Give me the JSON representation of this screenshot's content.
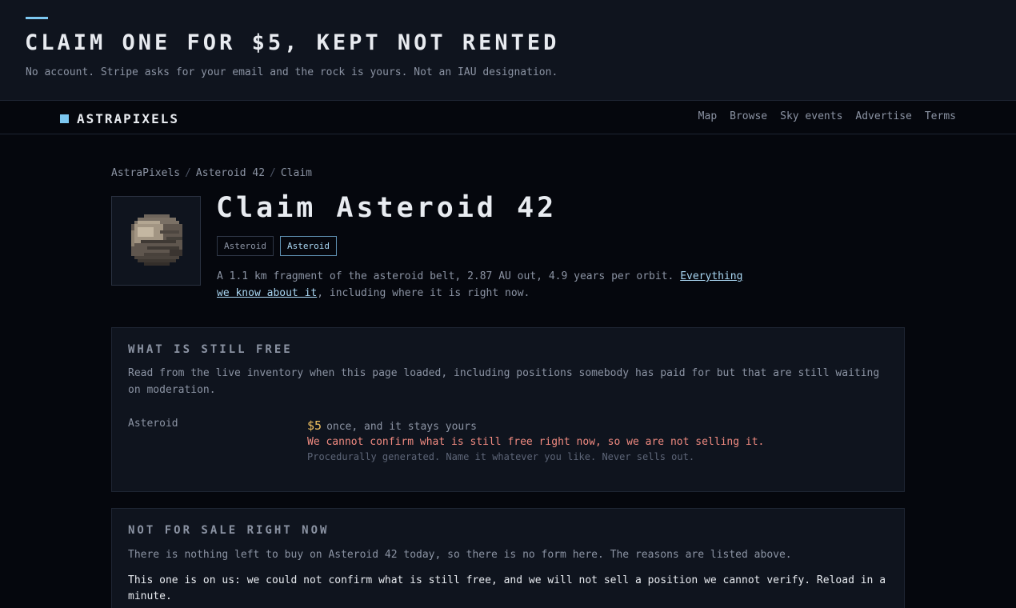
{
  "banner": {
    "title": "CLAIM ONE FOR $5, KEPT NOT RENTED",
    "subtitle": "No account. Stripe asks for your email and the rock is yours. Not an IAU designation."
  },
  "nav": {
    "logo": "ASTRAPIXELS",
    "links": [
      "Map",
      "Browse",
      "Sky events",
      "Advertise",
      "Terms"
    ]
  },
  "breadcrumb": [
    "AstraPixels",
    "Asteroid 42",
    "Claim"
  ],
  "page": {
    "title": "Claim Asteroid 42",
    "tags": [
      "Asteroid",
      "Asteroid"
    ],
    "description_prefix": "A 1.1 km fragment of the asteroid belt, 2.87 AU out, 4.9 years per orbit. ",
    "description_link": "Everything we know about it",
    "description_suffix": ", including where it is right now."
  },
  "free_panel": {
    "heading": "WHAT IS STILL FREE",
    "text": "Read from the live inventory when this page loaded, including positions somebody has paid for but that are still waiting on moderation.",
    "item_label": "Asteroid",
    "price": "$5",
    "price_suffix": "once, and it stays yours",
    "warning": "We cannot confirm what is still free right now, so we are not selling it.",
    "fine_print": "Procedurally generated. Name it whatever you like. Never sells out."
  },
  "sale_panel": {
    "heading": "NOT FOR SALE RIGHT NOW",
    "text": "There is nothing left to buy on Asteroid 42 today, so there is no form here. The reasons are listed above.",
    "note": "This one is on us: we could not confirm what is still free, and we will not sell a position we cannot verify. Reload in a minute."
  },
  "colors": {
    "accent": "#7cc7f0",
    "price": "#f0c060",
    "warning": "#f08a80"
  }
}
